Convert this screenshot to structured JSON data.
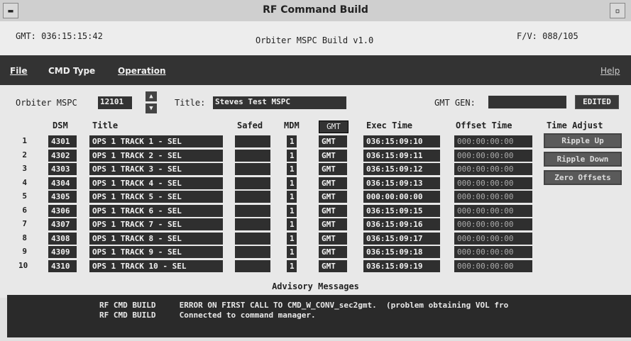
{
  "window": {
    "title": "RF Command Build"
  },
  "header": {
    "gmt": "GMT: 036:15:15:42",
    "app_title": "Orbiter MSPC Build v1.0",
    "fv": "F/V: 088/105"
  },
  "menu": {
    "file": "File",
    "cmd_type": "CMD Type",
    "operation": "Operation",
    "help": "Help"
  },
  "form": {
    "orbiter_label": "Orbiter MSPC",
    "orbiter_value": "12101",
    "title_label": "Title:",
    "title_value": "Steves Test MSPC",
    "gmt_gen_label": "GMT GEN:",
    "gmt_gen_value": "",
    "edited_label": "EDITED"
  },
  "table": {
    "headers": {
      "dsm": "DSM",
      "title": "Title",
      "safed": "Safed",
      "mdm": "MDM",
      "gmt": "GMT",
      "exec": "Exec Time",
      "offset": "Offset Time",
      "adjust": "Time Adjust"
    },
    "rows": [
      {
        "num": "1",
        "dsm": "4301",
        "title": "OPS 1 TRACK 1 - SEL",
        "safed": "",
        "mdm": "1",
        "gmt": "GMT",
        "exec": "036:15:09:10",
        "offset": "000:00:00:00"
      },
      {
        "num": "2",
        "dsm": "4302",
        "title": "OPS 1 TRACK 2 - SEL",
        "safed": "",
        "mdm": "1",
        "gmt": "GMT",
        "exec": "036:15:09:11",
        "offset": "000:00:00:00"
      },
      {
        "num": "3",
        "dsm": "4303",
        "title": "OPS 1 TRACK 3 - SEL",
        "safed": "",
        "mdm": "1",
        "gmt": "GMT",
        "exec": "036:15:09:12",
        "offset": "000:00:00:00"
      },
      {
        "num": "4",
        "dsm": "4304",
        "title": "OPS 1 TRACK 4 - SEL",
        "safed": "",
        "mdm": "1",
        "gmt": "GMT",
        "exec": "036:15:09:13",
        "offset": "000:00:00:00"
      },
      {
        "num": "5",
        "dsm": "4305",
        "title": "OPS 1 TRACK 5 - SEL",
        "safed": "",
        "mdm": "1",
        "gmt": "GMT",
        "exec": "000:00:00:00",
        "offset": "000:00:00:00"
      },
      {
        "num": "6",
        "dsm": "4306",
        "title": "OPS 1 TRACK 6 - SEL",
        "safed": "",
        "mdm": "1",
        "gmt": "GMT",
        "exec": "036:15:09:15",
        "offset": "000:00:00:00"
      },
      {
        "num": "7",
        "dsm": "4307",
        "title": "OPS 1 TRACK 7 - SEL",
        "safed": "",
        "mdm": "1",
        "gmt": "GMT",
        "exec": "036:15:09:16",
        "offset": "000:00:00:00"
      },
      {
        "num": "8",
        "dsm": "4308",
        "title": "OPS 1 TRACK 8 - SEL",
        "safed": "",
        "mdm": "1",
        "gmt": "GMT",
        "exec": "036:15:09:17",
        "offset": "000:00:00:00"
      },
      {
        "num": "9",
        "dsm": "4309",
        "title": "OPS 1 TRACK 9 - SEL",
        "safed": "",
        "mdm": "1",
        "gmt": "GMT",
        "exec": "036:15:09:18",
        "offset": "000:00:00:00"
      },
      {
        "num": "10",
        "dsm": "4310",
        "title": "OPS 1 TRACK 10 - SEL",
        "safed": "",
        "mdm": "1",
        "gmt": "GMT",
        "exec": "036:15:09:19",
        "offset": "000:00:00:00"
      }
    ]
  },
  "time_adjust": {
    "ripple_up": "Ripple Up",
    "ripple_down": "Ripple Down",
    "zero_offsets": "Zero Offsets"
  },
  "advisory": {
    "title": "Advisory Messages",
    "messages": [
      {
        "source": "RF CMD BUILD",
        "text": "ERROR ON FIRST CALL TO CMD_W_CONV_sec2gmt.  (problem obtaining VOL fro"
      },
      {
        "source": "RF CMD BUILD",
        "text": "Connected to command manager."
      }
    ]
  }
}
